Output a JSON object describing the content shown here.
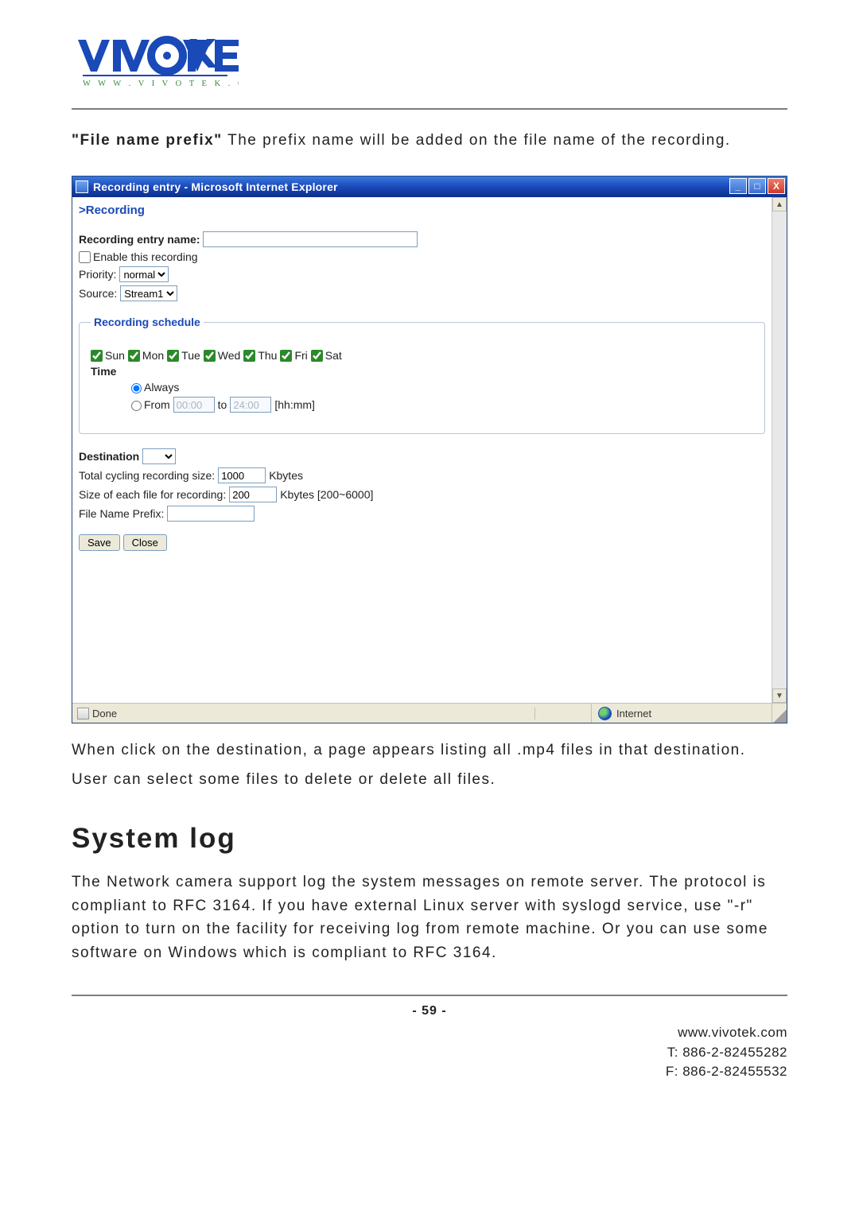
{
  "body": {
    "prefix_bold": "\"File name prefix\"",
    "prefix_rest": " The prefix name will be added on the file name of the recording.",
    "after_image_1": "When click on the destination, a page appears listing all .mp4 files in that destination.",
    "after_image_2": "User can select some files to delete or delete all files.",
    "syslog_heading": "System log",
    "syslog_p": "The Network camera support log the system messages on remote server. The protocol is compliant to RFC 3164. If you have external Linux server with syslogd service, use \"-r\" option to turn on the facility for receiving log from remote machine. Or you can use some software on Windows which is compliant to RFC 3164."
  },
  "ie": {
    "title": "Recording entry - Microsoft Internet Explorer",
    "section": ">Recording",
    "entry_name_label": "Recording entry name:",
    "entry_name_value": "",
    "enable_label": "Enable this recording",
    "priority_label": "Priority:",
    "priority_value": "normal",
    "source_label": "Source:",
    "source_value": "Stream1",
    "schedule_legend": "Recording schedule",
    "days": [
      "Sun",
      "Mon",
      "Tue",
      "Wed",
      "Thu",
      "Fri",
      "Sat"
    ],
    "time_label": "Time",
    "always": "Always",
    "from": "From",
    "to": "to",
    "time_from": "00:00",
    "time_to": "24:00",
    "time_fmt": "[hh:mm]",
    "destination_label": "Destination",
    "destination_value": "",
    "cycle_label": "Total cycling recording size:",
    "cycle_value": "1000",
    "cycle_unit": "Kbytes",
    "each_label": "Size of each file for recording:",
    "each_value": "200",
    "each_unit": "Kbytes [200~6000]",
    "prefix_label": "File Name Prefix:",
    "prefix_value": "",
    "save": "Save",
    "close": "Close",
    "status_done": "Done",
    "status_internet": "Internet",
    "win_min": "_",
    "win_max": "□",
    "win_close": "X"
  },
  "footer": {
    "page": "- 59 -",
    "url": "www.vivotek.com",
    "tel": "T: 886-2-82455282",
    "fax": "F: 886-2-82455532"
  }
}
